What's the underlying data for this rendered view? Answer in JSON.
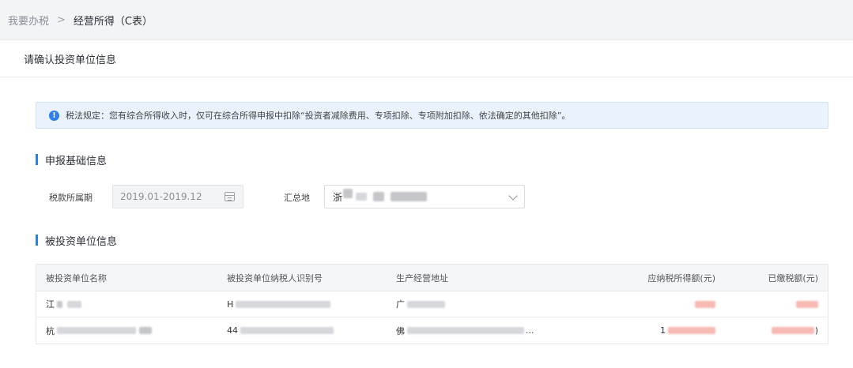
{
  "breadcrumb": {
    "root": "我要办税",
    "separator": ">",
    "current": "经营所得（C表）"
  },
  "card": {
    "title": "请确认投资单位信息"
  },
  "notice": {
    "icon": "info-icon",
    "text": "税法规定：您有综合所得收入时，仅可在综合所得申报中扣除“投资者减除费用、专项扣除、专项附加扣除、依法确定的其他扣除”。"
  },
  "basic_section": {
    "title": "申报基础信息",
    "period_label": "税款所属期",
    "period_value": "2019.01-2019.12",
    "location_label": "汇总地",
    "location_value_prefix": "浙"
  },
  "investee_section": {
    "title": "被投资单位信息",
    "columns": [
      "被投资单位名称",
      "被投资单位纳税人识别号",
      "生产经营地址",
      "应纳税所得额(元)",
      "已缴税额(元)"
    ],
    "rows": [
      {
        "name_prefix": "江",
        "tax_id_prefix": "H",
        "address_prefix": "广",
        "address_suffix": "",
        "taxable_prefix": "",
        "paid_prefix": "",
        "paid_suffix": ""
      },
      {
        "name_prefix": "杭",
        "tax_id_prefix": "44",
        "address_prefix": "佛",
        "address_suffix": "...",
        "taxable_prefix": "1",
        "paid_prefix": "",
        "paid_suffix": ")"
      }
    ]
  },
  "colors": {
    "accent": "#2f7fe8",
    "notice_bg": "#eaf3fd",
    "redacted_amount": "#f7b9b4"
  }
}
